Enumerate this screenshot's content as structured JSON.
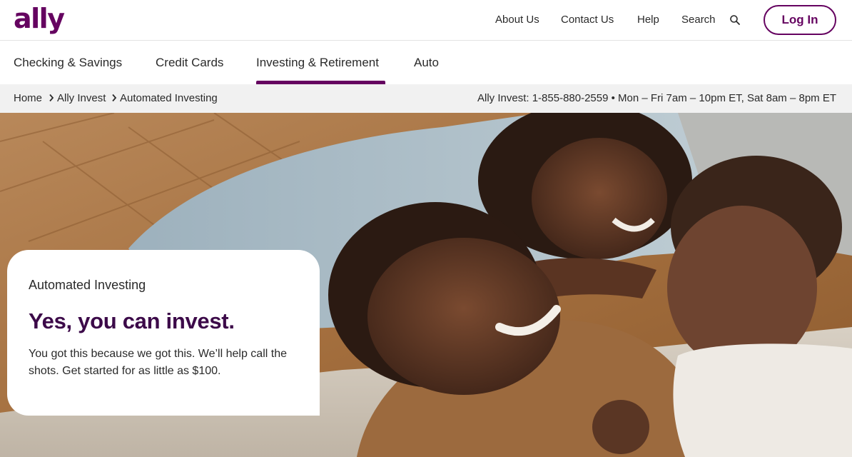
{
  "brand": {
    "logo_text": "ally",
    "accent": "#650360",
    "headline_color": "#3c0a49"
  },
  "utility_nav": {
    "links": [
      "About Us",
      "Contact Us",
      "Help",
      "Search"
    ],
    "search_icon": "search-icon",
    "login_label": "Log In"
  },
  "main_nav": {
    "items": [
      "Checking & Savings",
      "Credit Cards",
      "Investing & Retirement",
      "Auto"
    ],
    "active_index": 2
  },
  "breadcrumb": {
    "items": [
      "Home",
      "Ally Invest",
      "Automated Investing"
    ],
    "contact": "Ally Invest: 1-855-880-2559 •  Mon – Fri 7am – 10pm ET, Sat 8am – 8pm ET"
  },
  "hero": {
    "eyebrow": "Automated Investing",
    "headline": "Yes, you can invest.",
    "subtext": "You got this because we got this. We’ll help call the shots. Get started for as little as $100."
  }
}
